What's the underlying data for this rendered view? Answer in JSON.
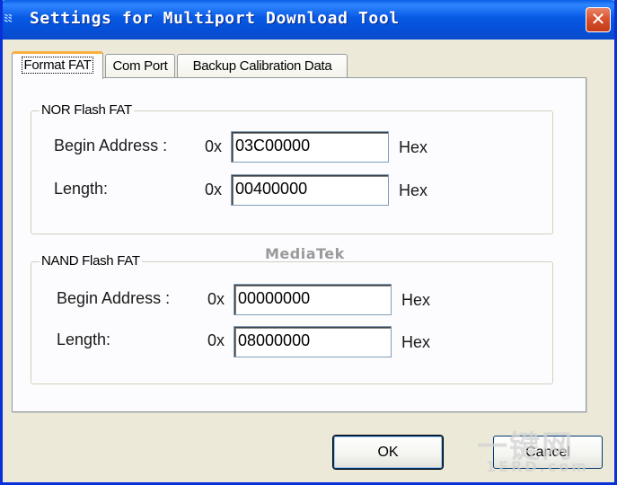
{
  "window": {
    "title": "Settings for Multiport Download Tool",
    "icon": "app-icon",
    "close_label": "✕"
  },
  "tabs": [
    {
      "label": "Format FAT",
      "active": true
    },
    {
      "label": "Com Port",
      "active": false
    },
    {
      "label": "Backup Calibration Data",
      "active": false
    }
  ],
  "nor": {
    "title": "NOR Flash FAT",
    "begin_label": "Begin Address :",
    "begin_prefix": "0x",
    "begin_value": "03C00000",
    "begin_suffix": "Hex",
    "length_label": "Length:",
    "length_prefix": "0x",
    "length_value": "00400000",
    "length_suffix": "Hex"
  },
  "watermark": "MediaTek",
  "nand": {
    "title": "NAND Flash FAT",
    "begin_label": "Begin Address :",
    "begin_prefix": "0x",
    "begin_value": "00000000",
    "begin_suffix": "Hex",
    "length_label": "Length:",
    "length_prefix": "0x",
    "length_value": "08000000",
    "length_suffix": "Hex"
  },
  "buttons": {
    "ok_label": "OK",
    "cancel_label": "Cancel"
  },
  "site_watermark": {
    "main": "一键网",
    "sub": "1ERD.com"
  },
  "colors": {
    "titlebar": "#0759e4",
    "close": "#d9532f",
    "active_tab_accent": "#f8b03c",
    "dialog_bg": "#ece9d8"
  }
}
